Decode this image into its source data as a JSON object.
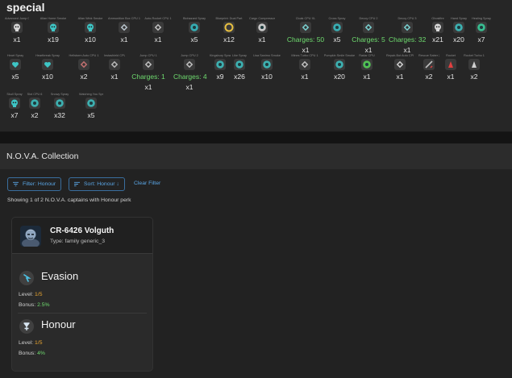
{
  "special": {
    "title": "special",
    "rows": [
      [
        {
          "name": "Advanced Jump CPU 1",
          "count": "x1",
          "icon": "skull-icon",
          "color": "#d8d8d8"
        },
        {
          "name": "Allan Home Smoke",
          "count": "x19",
          "icon": "skull-icon",
          "color": "#3ec6c6"
        },
        {
          "name": "Allan Wink Smoke",
          "count": "x10",
          "icon": "skull-icon",
          "color": "#3ec6c6"
        },
        {
          "name": "Ammunition Box CPU 1",
          "count": "x1",
          "icon": "chip-icon",
          "color": "#b8c4cc"
        },
        {
          "name": "Auto-Rocket CPU 1",
          "count": "x1",
          "icon": "play-chip-icon",
          "color": "#c0c0c0"
        },
        {
          "name": "Biohazard Spray",
          "count": "x5",
          "icon": "biohazard-icon",
          "color": "#35c2c9"
        },
        {
          "name": "Blueprint: Dual Part",
          "count": "x12",
          "icon": "ring-icon",
          "color": "#e8c040"
        },
        {
          "name": "Cargo Compressor",
          "count": "x1",
          "icon": "gear-icon",
          "color": "#e0e0e0"
        },
        {
          "name": "Cloak CPU XL",
          "count": "Charges: 50",
          "count2": "x1",
          "icon": "cloak-icon",
          "color": "#7ad0d0"
        },
        {
          "name": "Cross Spray",
          "count": "x5",
          "icon": "cross-icon",
          "color": "#39c3c9"
        },
        {
          "name": "Decoy CPU 2",
          "count": "Charges: 5",
          "count2": "x1",
          "icon": "decoy-icon",
          "color": "#7ad0d0"
        },
        {
          "name": "Decoy CPU 3",
          "count": "Charges: 32",
          "count2": "x1",
          "icon": "decoy-icon",
          "color": "#7ad0d0"
        },
        {
          "name": "Ghostfire",
          "count": "x21",
          "icon": "ghost-icon",
          "color": "#d8d8d8"
        },
        {
          "name": "Hand Spray",
          "count": "x20",
          "icon": "hand-icon",
          "color": "#3ec6c6"
        },
        {
          "name": "Healing Spray",
          "count": "x7",
          "icon": "heal-icon",
          "color": "#38d6a0"
        }
      ],
      [
        {
          "name": "Heart Spray",
          "count": "x5",
          "icon": "heart-icon",
          "color": "#3ec6c6"
        },
        {
          "name": "Heartbreak Spray",
          "count": "x10",
          "icon": "heartbreak-icon",
          "color": "#3ec6c6"
        },
        {
          "name": "Hellstorm Auto CPU 1",
          "count": "x2",
          "icon": "chip-icon",
          "color": "#c07070"
        },
        {
          "name": "Instashield CPU 1",
          "count": "x1",
          "icon": "shield-chip-icon",
          "color": "#b8b8b8"
        },
        {
          "name": "Jump CPU 1",
          "count": "Charges: 1",
          "count2": "x1",
          "icon": "jump-icon",
          "color": "#c0c0c0"
        },
        {
          "name": "Jump CPU 2",
          "count": "Charges: 4",
          "count2": "x1",
          "icon": "jump-icon",
          "color": "#c0c0c0"
        },
        {
          "name": "Kingsbury Spray",
          "count": "x9",
          "icon": "crown-icon",
          "color": "#3ec6c6"
        },
        {
          "name": "Like Spray",
          "count": "x26",
          "icon": "like-icon",
          "color": "#3ec6c6"
        },
        {
          "name": "Lisa Sanimo Smoke",
          "count": "x10",
          "icon": "smoke-icon",
          "color": "#3ec6c6"
        },
        {
          "name": "Mines Turbo CPU 1",
          "count": "x1",
          "icon": "mine-icon",
          "color": "#c0c0c0"
        },
        {
          "name": "Pumpkin Smile Smoke",
          "count": "x20",
          "icon": "pumpkin-icon",
          "color": "#3ec6c6"
        },
        {
          "name": "Radar CPU",
          "count": "x1",
          "icon": "radar-icon",
          "color": "#58d858"
        },
        {
          "name": "Repair-Bot Auto CPU",
          "count": "x1",
          "icon": "repair-icon",
          "color": "#d0d0d0"
        },
        {
          "name": "Rescue Saber 2",
          "count": "x2",
          "icon": "saber-icon",
          "color": "#c0c0c0"
        },
        {
          "name": "Rocket",
          "count": "x1",
          "icon": "rocket-icon",
          "color": "#e04040"
        },
        {
          "name": "Rocket Turbo 1",
          "count": "x2",
          "icon": "rocket-turbo-icon",
          "color": "#d0d0d0"
        }
      ],
      [
        {
          "name": "Skull Spray",
          "count": "x7",
          "icon": "skull-icon",
          "color": "#3ec6c6"
        },
        {
          "name": "Slot CPU 6",
          "count": "x2",
          "icon": "slot-icon",
          "color": "#3ec6c6"
        },
        {
          "name": "Snowy Spray",
          "count": "x32",
          "icon": "snow-icon",
          "color": "#3ec6c6"
        },
        {
          "name": "Watching You Spray",
          "count": "x5",
          "icon": "eye-icon",
          "color": "#3ec6c6"
        }
      ]
    ]
  },
  "nova": {
    "title": "N.O.V.A. Collection",
    "filter_label": "Filter: Honour",
    "sort_label": "Sort: Honour ↓",
    "clear_label": "Clear Filter",
    "showing_text": "Showing 1 of 2 N.O.V.A. captains with Honour perk",
    "card": {
      "name": "CR-6426 Volguth",
      "type": "Type: family generic_3",
      "perks": [
        {
          "name": "Evasion",
          "level_label": "Level: ",
          "level": "1/5",
          "bonus_label": "Bonus: ",
          "bonus": "2.5%",
          "icon": "evasion-icon"
        },
        {
          "name": "Honour",
          "level_label": "Level: ",
          "level": "1/5",
          "bonus_label": "Bonus: ",
          "bonus": "4%",
          "icon": "honour-icon"
        }
      ]
    }
  },
  "colors": {
    "accent": "#5aa6e6",
    "charges": "#6fdc6f",
    "level": "#e6a330",
    "bonus": "#6fdc6f"
  }
}
